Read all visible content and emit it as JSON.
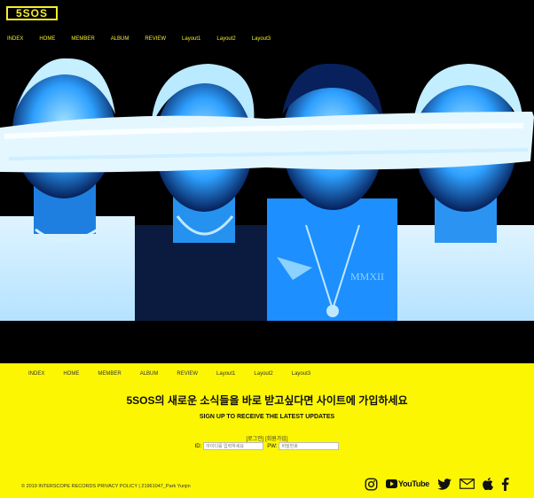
{
  "logo": {
    "text": "5SOS"
  },
  "top_nav": [
    "INDEX",
    "HOME",
    "MEMBER",
    "ALBUM",
    "REVIEW",
    "Layout1",
    "Layout2",
    "Layout3"
  ],
  "footer_nav": [
    "INDEX",
    "HOME",
    "MEMBER",
    "ALBUM",
    "REVIEW",
    "Layout1",
    "Layout2",
    "Layout3"
  ],
  "signup": {
    "headline": "5SOS의 새로운 소식들을 바로 받고싶다면 사이트에 가입하세요",
    "subline": "SIGN UP TO RECEIVE THE LATEST UPDATES",
    "login_link": "[로그인]",
    "join_link": "[회원가입]",
    "id_label": "ID:",
    "id_placeholder": "아이디를 입력하세요",
    "pw_label": "PW:",
    "pw_placeholder": "비밀번호"
  },
  "copyright": "© 2019 INTERSCOPE RECORDS PRIVACY POLICY | 21961047_Park Yunjin",
  "social": {
    "youtube_text": "YouTube",
    "icons": [
      "instagram-icon",
      "youtube-icon",
      "twitter-icon",
      "mail-icon",
      "apple-icon",
      "facebook-icon"
    ]
  },
  "colors": {
    "accent": "#f7ee2a",
    "footer_bg": "#fcf602",
    "hero_blue": "#1a8cff"
  }
}
